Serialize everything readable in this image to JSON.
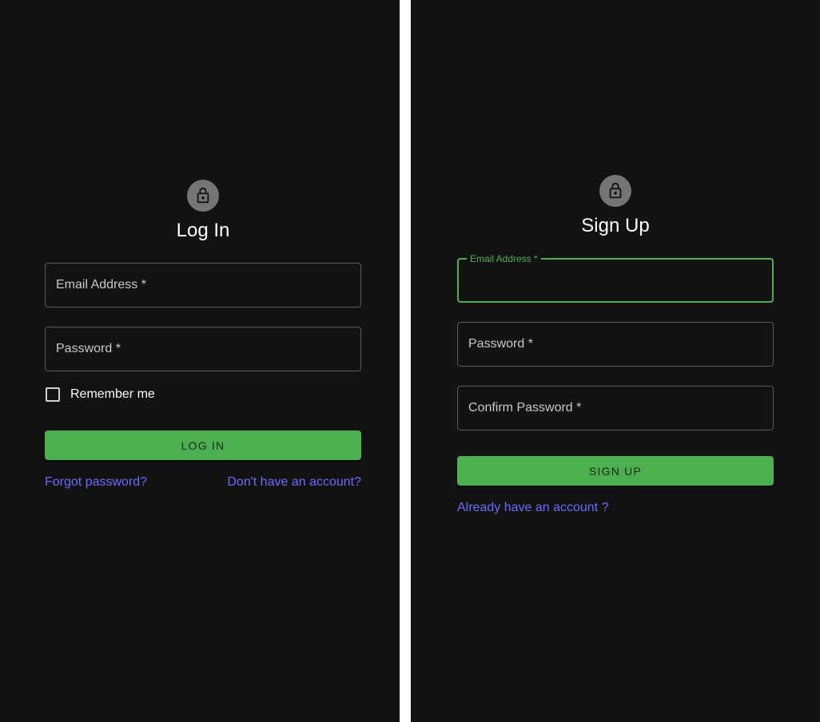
{
  "login": {
    "title": "Log In",
    "email_label": "Email Address *",
    "password_label": "Password *",
    "remember_label": "Remember me",
    "remember_checked": false,
    "submit_label": "LOG IN",
    "forgot_link": "Forgot password?",
    "signup_link": "Don't have an account?"
  },
  "signup": {
    "title": "Sign Up",
    "email_label": "Email Address *",
    "email_value": "",
    "password_label": "Password *",
    "confirm_label": "Confirm Password *",
    "submit_label": "SIGN UP",
    "login_link": "Already have an account ?"
  },
  "icons": {
    "avatar": "lock-icon"
  },
  "colors": {
    "background": "#121212",
    "accent": "#4caf50",
    "link": "#6a6aff",
    "avatar": "#757575",
    "divider": "#ffffff"
  }
}
